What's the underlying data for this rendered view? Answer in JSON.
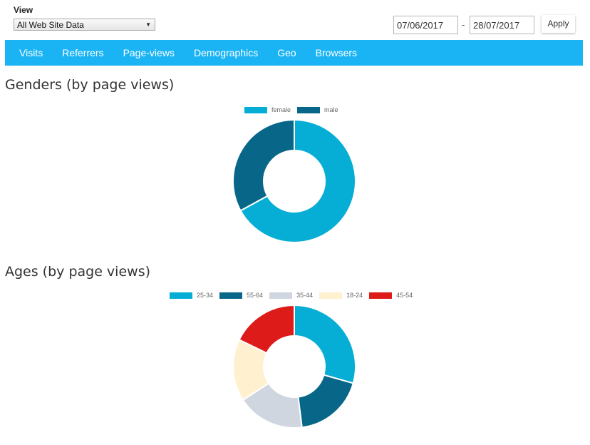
{
  "header": {
    "view_label": "View",
    "view_selected": "All Web Site Data",
    "date_from": "07/06/2017",
    "date_separator": "-",
    "date_to": "28/07/2017",
    "apply_label": "Apply"
  },
  "nav": {
    "items": [
      "Visits",
      "Referrers",
      "Page-views",
      "Demographics",
      "Geo",
      "Browsers"
    ],
    "color": "#1ab4f5"
  },
  "chart_data": [
    {
      "type": "pie",
      "variant": "doughnut",
      "title": "Genders (by page views)",
      "legend_position": "top",
      "labels": [
        "female",
        "male"
      ],
      "values": [
        67,
        33
      ],
      "value_unit": "percent (estimated)",
      "colors": [
        "#06aed5",
        "#086788"
      ]
    },
    {
      "type": "pie",
      "variant": "doughnut",
      "title": "Ages (by page views)",
      "legend_position": "top",
      "labels": [
        "25-34",
        "55-64",
        "35-44",
        "18-24",
        "45-54"
      ],
      "values": [
        29.4,
        18.6,
        17.8,
        16.4,
        17.8
      ],
      "value_unit": "percent (estimated)",
      "colors": [
        "#06aed5",
        "#086788",
        "#cfd6e0",
        "#fff1d0",
        "#dd1c1a"
      ]
    }
  ]
}
